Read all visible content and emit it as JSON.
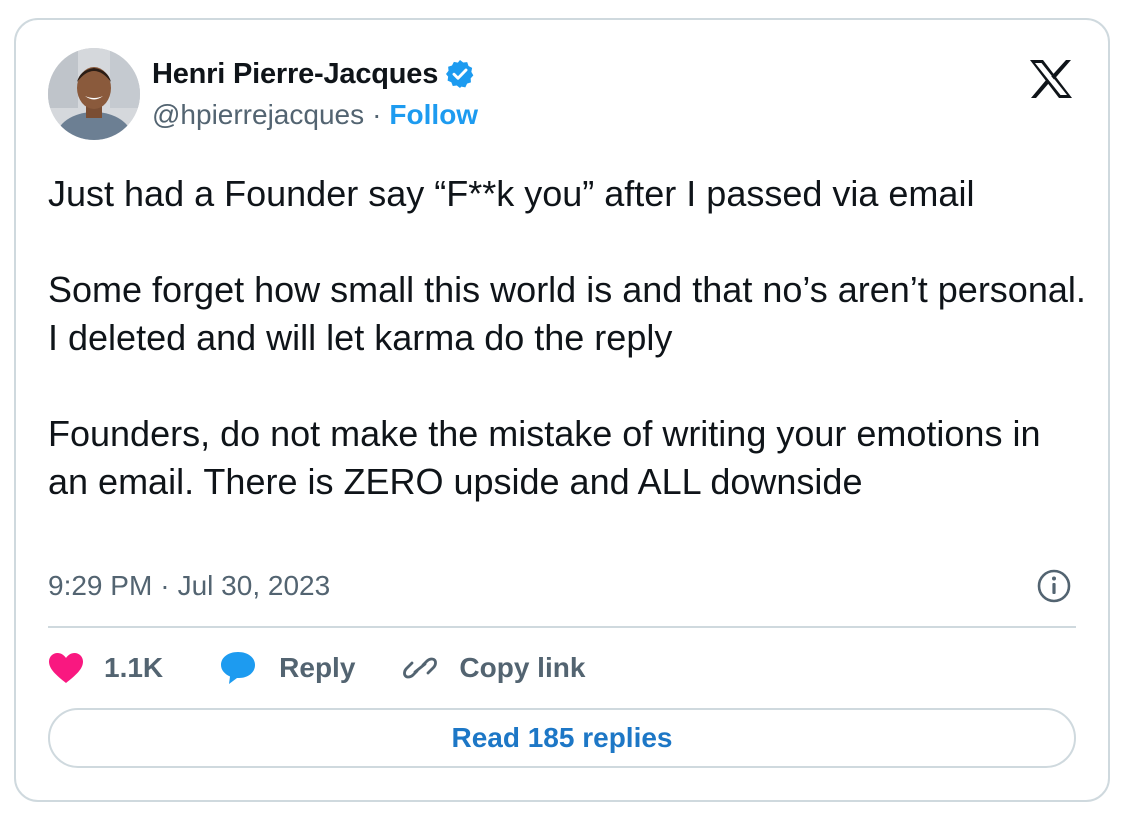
{
  "author": {
    "display_name": "Henri Pierre-Jacques",
    "handle": "@hpierrejacques",
    "separator": "·",
    "follow_label": "Follow",
    "verified": true,
    "verified_icon": "verified-badge-icon"
  },
  "brand": {
    "logo": "x-logo-icon"
  },
  "tweet": {
    "paragraphs": [
      "Just had a Founder say “F**k you” after I passed via email",
      "Some forget how small this world is and that no’s aren’t personal. I deleted and will let karma do the reply",
      "Founders, do not make the mistake of writing your emotions in an email. There is ZERO upside and ALL downside"
    ],
    "time": "9:29 PM",
    "separator": "·",
    "date": "Jul 30, 2023",
    "info_icon": "info-icon"
  },
  "actions": {
    "like_count": "1.1K",
    "reply_label": "Reply",
    "copy_link_label": "Copy link"
  },
  "read_replies_label": "Read 185 replies",
  "colors": {
    "accent": "#1d9bf0",
    "heart": "#f91880",
    "text": "#0f1419",
    "muted": "#536471",
    "border": "#cfd9de"
  }
}
